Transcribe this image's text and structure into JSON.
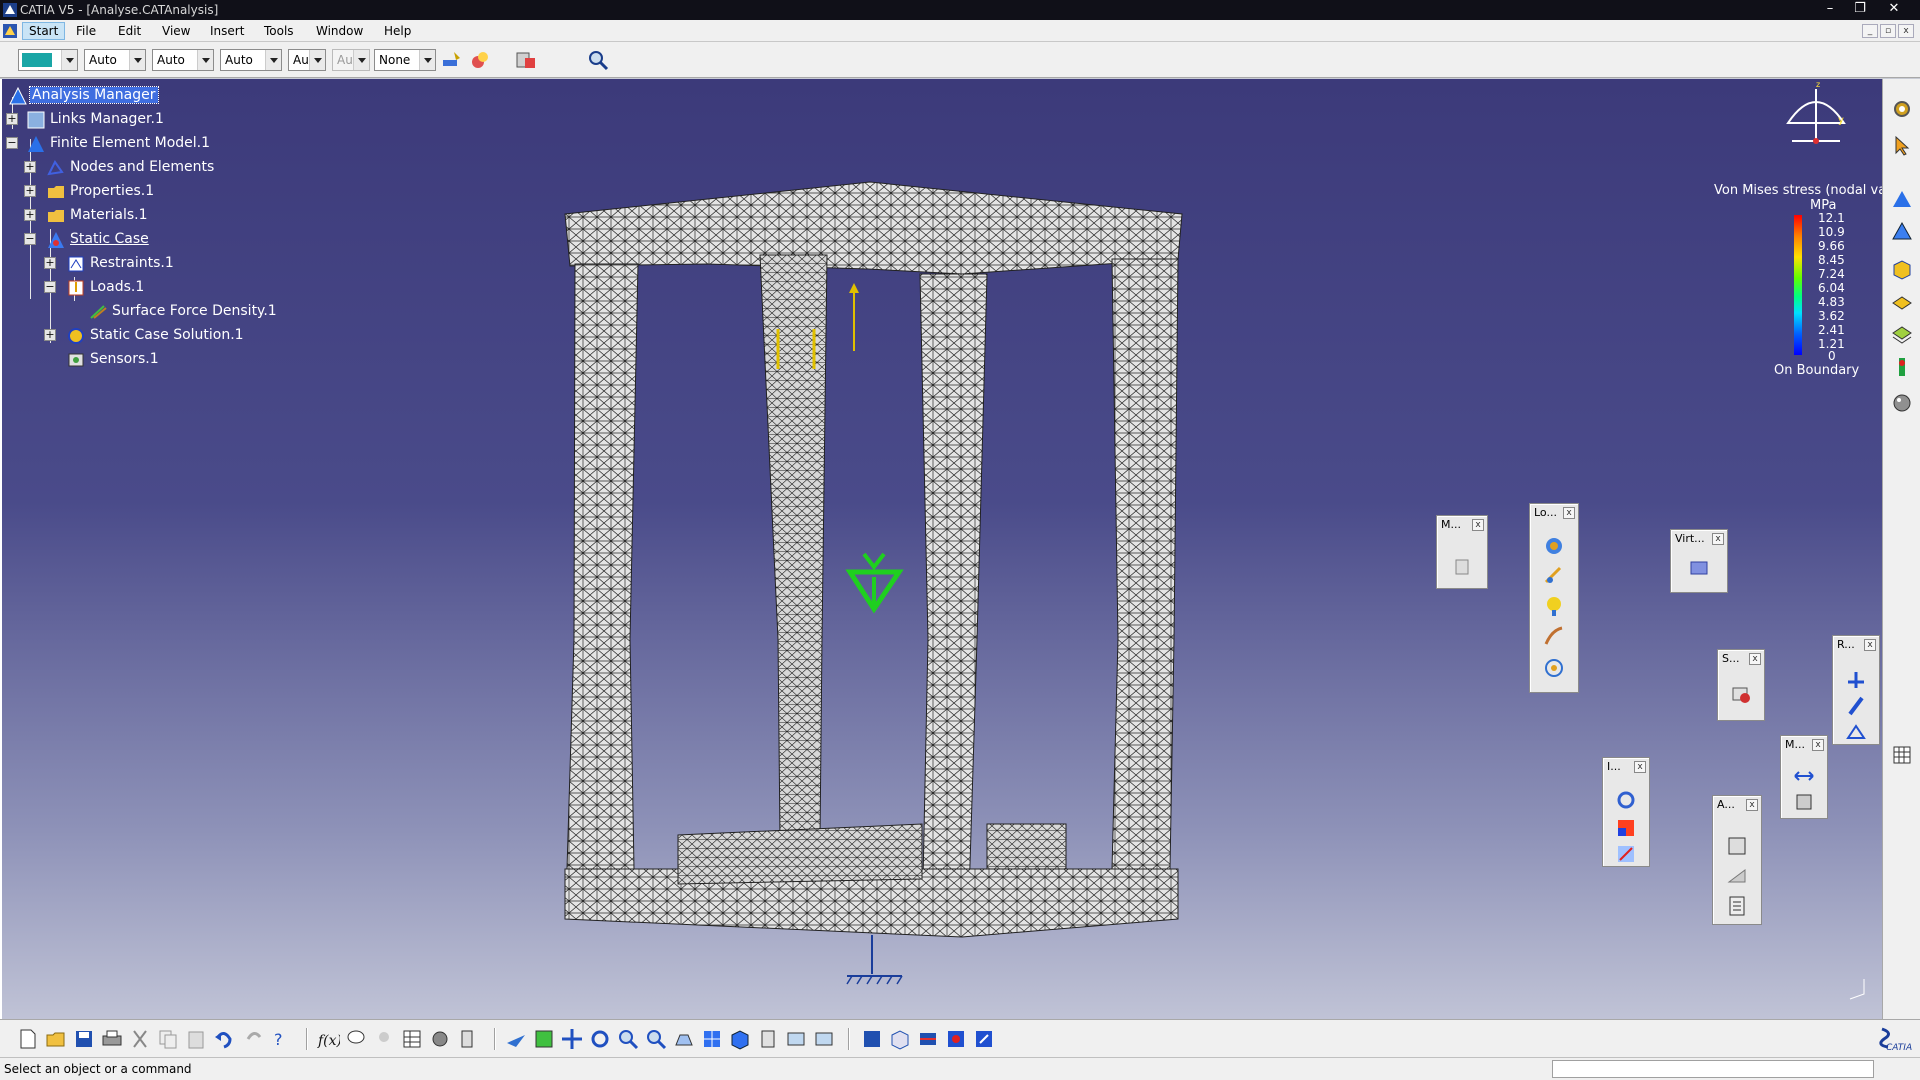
{
  "window": {
    "title": "CATIA V5 - [Analyse.CATAnalysis]",
    "minimize": "–",
    "restore": "❐",
    "close": "✕"
  },
  "menu": {
    "items": [
      "Start",
      "File",
      "Edit",
      "View",
      "Insert",
      "Tools",
      "Window",
      "Help"
    ]
  },
  "toolbar_top": {
    "combo_color": "",
    "combo1": "Auto",
    "combo2": "Auto",
    "combo3": "Auto",
    "combo4": "Aut",
    "combo5": "Aut",
    "combo6": "None"
  },
  "tree": {
    "root": "Analysis Manager",
    "links_manager": "Links Manager.1",
    "fem": "Finite Element Model.1",
    "nodes": "Nodes and Elements",
    "properties": "Properties.1",
    "materials": "Materials.1",
    "static_case": "Static Case",
    "restraints": "Restraints.1",
    "loads": "Loads.1",
    "surface_force": "Surface Force Density.1",
    "solution": "Static Case Solution.1",
    "sensors": "Sensors.1"
  },
  "legend": {
    "title": "Von Mises stress (nodal val",
    "unit": "MPa",
    "values": [
      "12.1",
      "10.9",
      "9.66",
      "8.45",
      "7.24",
      "6.04",
      "4.83",
      "3.62",
      "2.41",
      "1.21",
      "0"
    ],
    "footer": "On Boundary",
    "scale_colors": [
      "#ff0000",
      "#ff8000",
      "#ffe000",
      "#60ff00",
      "#00ff80",
      "#00e0ff",
      "#0060ff",
      "#0000ff"
    ]
  },
  "floating_toolbars": {
    "model": "M...",
    "loads": "Lo...",
    "virtual": "Virt...",
    "solve": "S...",
    "restraints": "R...",
    "measure": "M...",
    "images": "I...",
    "analysis": "A...",
    "close": "x"
  },
  "status": {
    "text": "Select an object or a command"
  },
  "brand": "CATIA",
  "colors": {
    "viewport_top": "#3c3a7a",
    "selection": "#3f6ee0",
    "mesh_fill": "#e4e4e4"
  }
}
